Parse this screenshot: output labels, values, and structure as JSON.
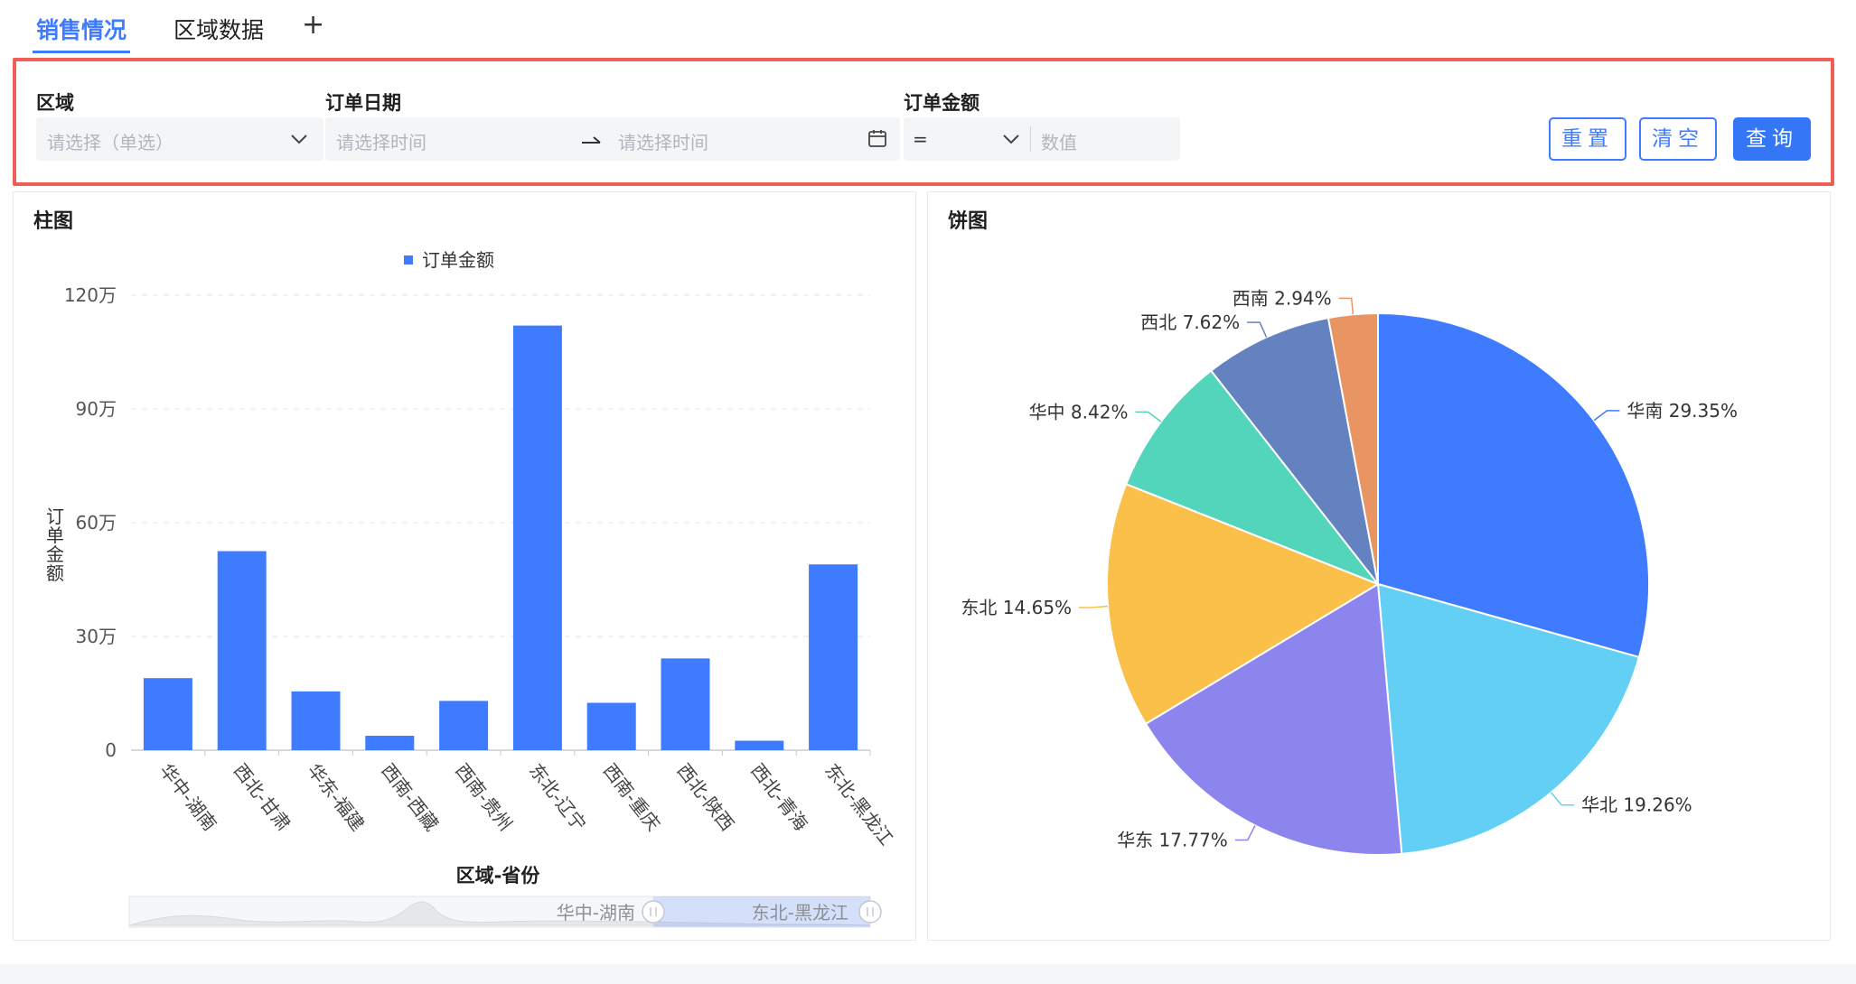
{
  "tabs": [
    {
      "label": "销售情况",
      "active": true
    },
    {
      "label": "区域数据",
      "active": false
    }
  ],
  "tab_add_label": "+",
  "filters": {
    "region": {
      "label": "区域",
      "placeholder": "请选择（单选）"
    },
    "order_date": {
      "label": "订单日期",
      "start_placeholder": "请选择时间",
      "end_placeholder": "请选择时间"
    },
    "order_amount": {
      "label": "订单金额",
      "operator": "=",
      "value_placeholder": "数值"
    }
  },
  "buttons": {
    "reset": "重置",
    "clear": "清空",
    "query": "查询"
  },
  "colors": {
    "accent": "#3f7bff",
    "highlight_border": "#f05f55"
  },
  "bar_card_title": "柱图",
  "pie_card_title": "饼图",
  "chart_data": [
    {
      "type": "bar",
      "legend": [
        "订单金额"
      ],
      "legend_position": "top",
      "categories": [
        "华中-湖南",
        "西北-甘肃",
        "华东-福建",
        "西南-西藏",
        "西南-贵州",
        "东北-辽宁",
        "西南-重庆",
        "西北-陕西",
        "西北-青海",
        "东北-黑龙江"
      ],
      "series": [
        {
          "name": "订单金额",
          "values": [
            190000,
            525000,
            155000,
            38000,
            130000,
            1120000,
            125000,
            242000,
            25000,
            490000
          ]
        }
      ],
      "yticks": [
        "0",
        "30万",
        "60万",
        "90万",
        "120万"
      ],
      "ylim": [
        0,
        1200000
      ],
      "xlabel": "区域-省份",
      "ylabel": "订单金额",
      "grid": true,
      "color": "#3f7bff",
      "slider": {
        "start_label": "华中-湖南",
        "end_label": "东北-黑龙江"
      }
    },
    {
      "type": "pie",
      "slices": [
        {
          "label": "华南",
          "value": 29.35,
          "text": "华南 29.35%",
          "color": "#3f7bff"
        },
        {
          "label": "华北",
          "value": 19.26,
          "text": "华北 19.26%",
          "color": "#63cff5"
        },
        {
          "label": "华东",
          "value": 17.77,
          "text": "华东 17.77%",
          "color": "#8c85ee"
        },
        {
          "label": "东北",
          "value": 14.65,
          "text": "东北 14.65%",
          "color": "#fbc04a"
        },
        {
          "label": "华中",
          "value": 8.42,
          "text": "华中 8.42%",
          "color": "#52d5bb"
        },
        {
          "label": "西北",
          "value": 7.62,
          "text": "西北 7.62%",
          "color": "#6582c0"
        },
        {
          "label": "西南",
          "value": 2.94,
          "text": "西南 2.94%",
          "color": "#e99563"
        }
      ]
    }
  ]
}
